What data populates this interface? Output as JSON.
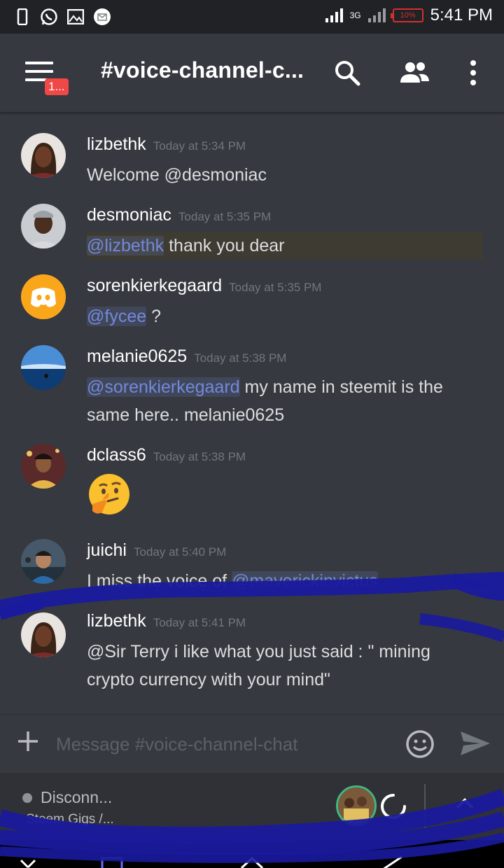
{
  "status_bar": {
    "time": "5:41 PM",
    "battery": "10%",
    "network": "3G"
  },
  "header": {
    "channel_title": "#voice-channel-c...",
    "menu_badge": "1..."
  },
  "messages": [
    {
      "author": "lizbethk",
      "timestamp": "Today at 5:34 PM",
      "segments": [
        {
          "text": "Welcome @desmoniac"
        }
      ]
    },
    {
      "author": "desmoniac",
      "timestamp": "Today at 5:35 PM",
      "segments": [
        {
          "mention": "@lizbethk"
        },
        {
          "text": " thank you dear"
        }
      ]
    },
    {
      "author": "sorenkierkegaard",
      "timestamp": "Today at 5:35 PM",
      "segments": [
        {
          "mention": "@fycee"
        },
        {
          "text": " ?"
        }
      ]
    },
    {
      "author": "melanie0625",
      "timestamp": "Today at 5:38 PM",
      "segments": [
        {
          "mention": "@sorenkierkegaard"
        },
        {
          "text": " my name in steemit is the"
        }
      ],
      "line2": "same here.. melanie0625"
    },
    {
      "author": "dclass6",
      "timestamp": "Today at 5:38 PM",
      "emoji": "🤔"
    },
    {
      "author": "juichi",
      "timestamp": "Today at 5:40 PM",
      "segments": [
        {
          "text": "I miss the voice of "
        },
        {
          "mention": "@maverickinvictus"
        }
      ]
    },
    {
      "author": "lizbethk",
      "timestamp": "Today at 5:41 PM",
      "line1": "@Sir Terry i like what you just said : \" mining",
      "line2": "crypto currency with your mind\""
    }
  ],
  "composer": {
    "placeholder": "Message #voice-channel-chat"
  },
  "voice": {
    "status": "Disconn...",
    "server": "Steem Gigs /..."
  },
  "colors": {
    "background": "#36393f",
    "mention": "#7289da",
    "scribble": "#1a1a9e"
  }
}
